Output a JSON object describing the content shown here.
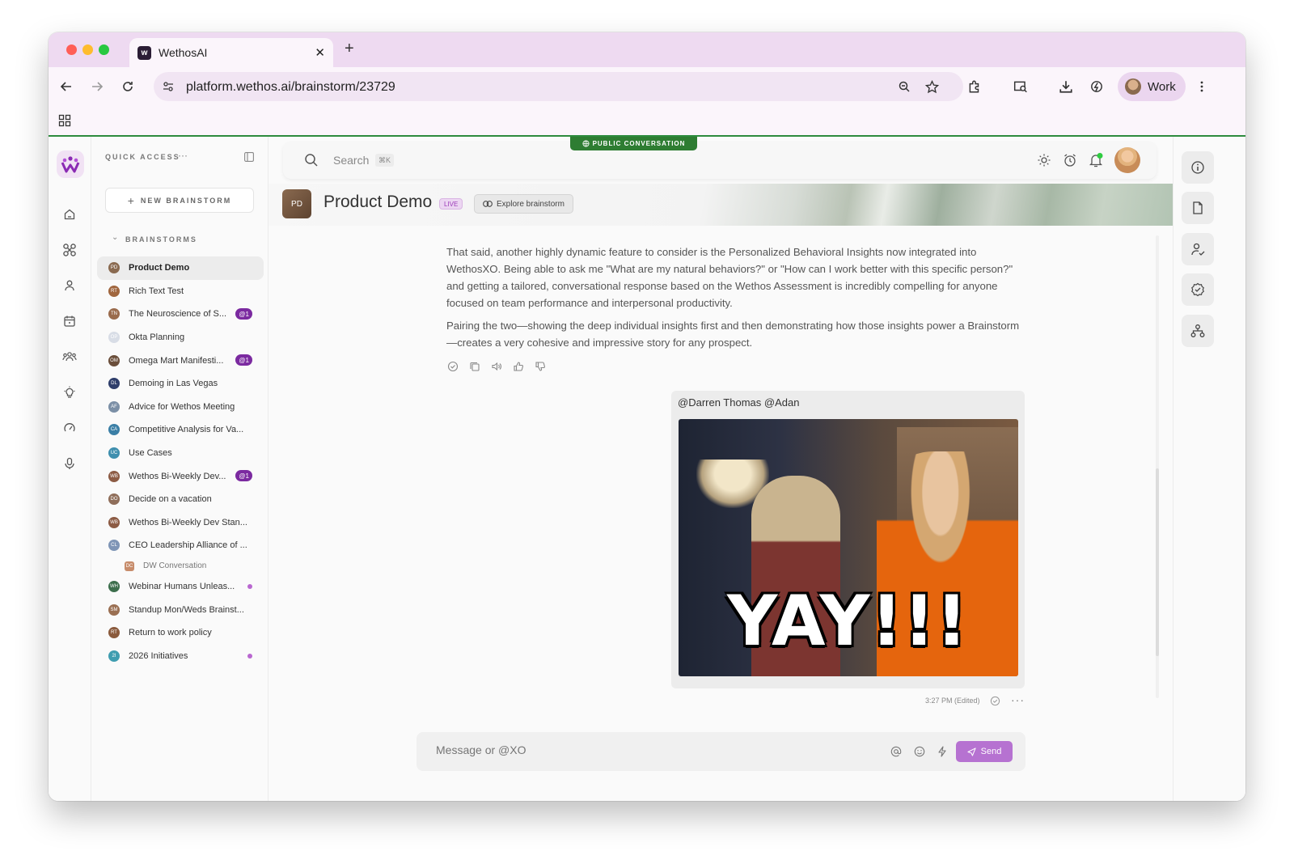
{
  "browser": {
    "tab_title": "WethosAI",
    "url": "platform.wethos.ai/brainstorm/23729",
    "profile_label": "Work",
    "new_tab_label": "+",
    "close_tab_label": "✕"
  },
  "sidebar": {
    "quick_access_label": "QUICK ACCESS",
    "quick_access_more": "···",
    "new_brainstorm_label": "NEW BRAINSTORM",
    "brainstorms_heading": "BRAINSTORMS",
    "items": [
      {
        "initials": "PD",
        "label": "Product Demo",
        "color": "#8a6a50",
        "active": true
      },
      {
        "initials": "RT",
        "label": "Rich Text Test",
        "color": "#a0663e"
      },
      {
        "initials": "TN",
        "label": "The Neuroscience of S...",
        "color": "#9a6b4c",
        "badge": "@1"
      },
      {
        "initials": "OP",
        "label": "Okta Planning",
        "color": "#d8dde6"
      },
      {
        "initials": "OM",
        "label": "Omega Mart Manifesti...",
        "color": "#6a4e3a",
        "badge": "@1"
      },
      {
        "initials": "DL",
        "label": "Demoing in Las Vegas",
        "color": "#2f3e6b"
      },
      {
        "initials": "AF",
        "label": "Advice for Wethos Meeting",
        "color": "#7b8fa6"
      },
      {
        "initials": "CA",
        "label": "Competitive Analysis for Va...",
        "color": "#3b7fa6"
      },
      {
        "initials": "UC",
        "label": "Use Cases",
        "color": "#3f8fae"
      },
      {
        "initials": "WB",
        "label": "Wethos Bi-Weekly Dev...",
        "color": "#8c5b44",
        "badge": "@1"
      },
      {
        "initials": "DO",
        "label": "Decide on a vacation",
        "color": "#8f6e5a"
      },
      {
        "initials": "WB",
        "label": "Wethos Bi-Weekly Dev Stan...",
        "color": "#8c5b44"
      },
      {
        "initials": "CL",
        "label": "CEO Leadership Alliance of ...",
        "color": "#7f95b6"
      },
      {
        "initials": "DC",
        "label": "DW Conversation",
        "color": "#c78c6b",
        "sub": true
      },
      {
        "initials": "WH",
        "label": "Webinar Humans Unleas...",
        "color": "#3c6e4c",
        "dot": true
      },
      {
        "initials": "SM",
        "label": "Standup Mon/Weds Brainst...",
        "color": "#9a6f52"
      },
      {
        "initials": "RT",
        "label": "Return to work policy",
        "color": "#8a5a3c"
      },
      {
        "initials": "2I",
        "label": "2026 Initiatives",
        "color": "#3f9db0",
        "dot": true
      }
    ]
  },
  "topbar": {
    "public_label": "PUBLIC CONVERSATION",
    "search_placeholder": "Search",
    "search_shortcut": "⌘K"
  },
  "conversation": {
    "avatar_initials": "PD",
    "title": "Product Demo",
    "live_label": "LIVE",
    "explore_label": "Explore brainstorm"
  },
  "messages": {
    "ai_paragraph_1": "That said, another highly dynamic feature to consider is the Personalized Behavioral Insights now integrated into WethosXO. Being able to ask me \"What are my natural behaviors?\" or \"How can I work better with this specific person?\" and getting a tailored, conversational response based on the Wethos Assessment is incredibly compelling for anyone focused on team performance and interpersonal productivity.",
    "ai_paragraph_2": "Pairing the two—showing the deep individual insights first and then demonstrating how those insights power a Brainstorm—creates a very cohesive and impressive story for any prospect.",
    "user_mentions": "@Darren Thomas @Adan",
    "gif_caption": "YAY!!!",
    "timestamp": "3:27 PM (Edited)",
    "more_label": "···"
  },
  "composer": {
    "placeholder": "Message or @XO",
    "send_label": "Send"
  },
  "colors": {
    "accent_purple": "#b672d1",
    "badge_purple": "#7b2aa0",
    "public_green": "#2e7d32"
  }
}
